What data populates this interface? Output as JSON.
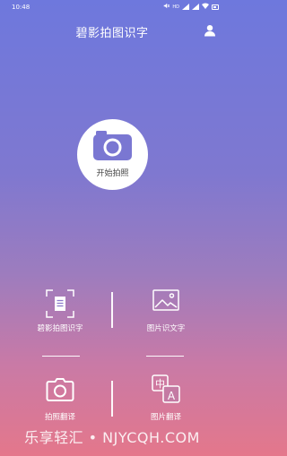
{
  "status_bar": {
    "time": "10:48"
  },
  "app_bar": {
    "title": "碧影拍图识字"
  },
  "start": {
    "label": "开始拍照"
  },
  "features": [
    {
      "label": "碧影拍图识字",
      "icon": "document-scan-icon"
    },
    {
      "label": "图片识文字",
      "icon": "image-icon"
    },
    {
      "label": "拍照翻译",
      "icon": "camera-icon"
    },
    {
      "label": "图片翻译",
      "icon": "translate-icon"
    }
  ],
  "watermark": "乐享轻汇 • NJYCQH.COM"
}
